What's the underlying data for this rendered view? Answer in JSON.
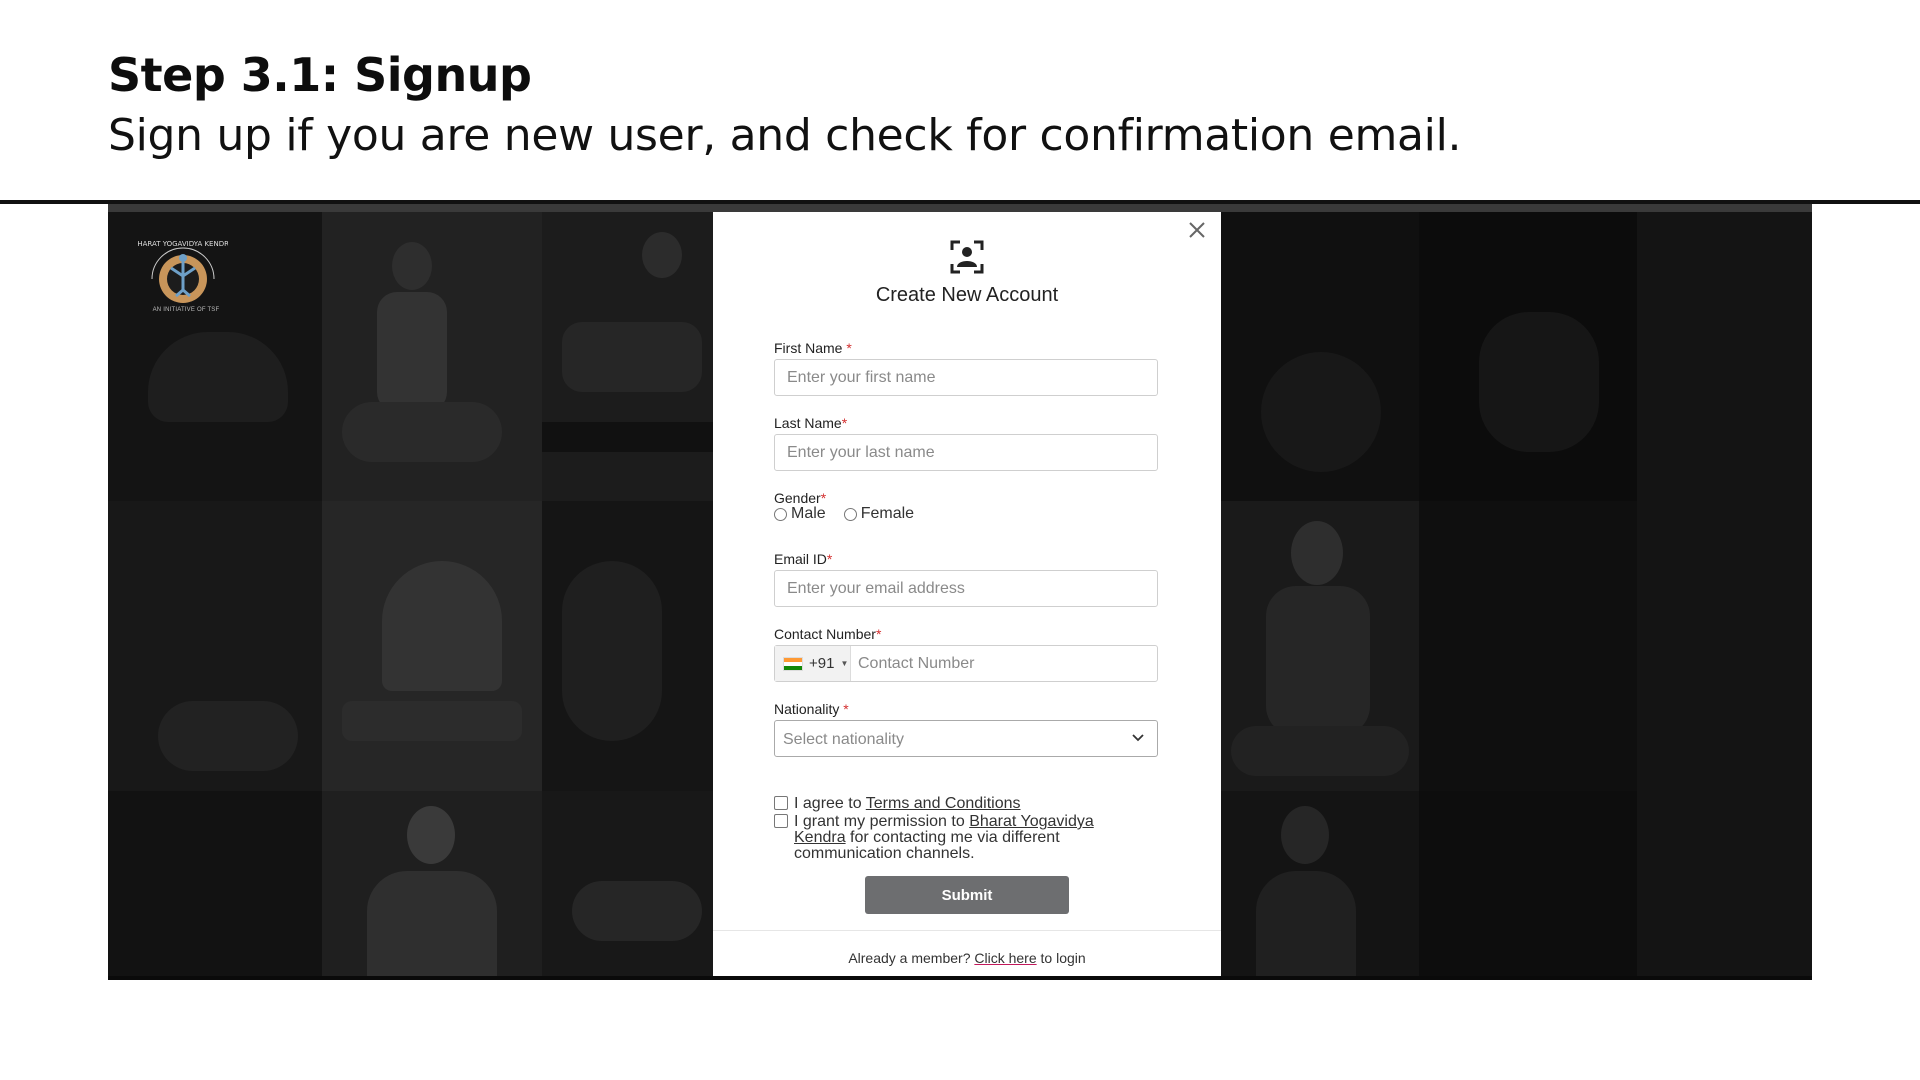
{
  "slide": {
    "title": "Step 3.1: Signup",
    "subtitle": "Sign up if you are new user, and check for confirmation email."
  },
  "logo": {
    "name": "BHARAT YOGAVIDYA KENDRA",
    "caption": "AN INITIATIVE OF TSF"
  },
  "modal": {
    "title": "Create New Account",
    "icons": {
      "header": "account-box-icon",
      "close": "close-icon"
    },
    "fields": {
      "first_name": {
        "label": "First Name",
        "placeholder": "Enter your first name"
      },
      "last_name": {
        "label": "Last Name",
        "placeholder": "Enter your last name"
      },
      "gender": {
        "label": "Gender",
        "options": [
          "Male",
          "Female"
        ]
      },
      "email": {
        "label": "Email ID",
        "placeholder": "Enter your email address"
      },
      "contact": {
        "label": "Contact Number",
        "country_code": "+91",
        "placeholder": "Contact Number"
      },
      "nationality": {
        "label": "Nationality",
        "placeholder": "Select nationality"
      }
    },
    "required_marker": "*",
    "consents": {
      "terms_prefix": "I agree to",
      "terms_link": "Terms and Conditions",
      "permission_prefix": "I grant my permission to",
      "permission_link": "Bharat Yogavidya Kendra",
      "permission_suffix": "for contacting me via different communication channels."
    },
    "submit_label": "Submit",
    "footer": {
      "prefix": "Already a member?",
      "link": "Click here",
      "suffix": "to login"
    }
  },
  "colors": {
    "submit_bg": "#6d6e70",
    "required": "#d32f2f",
    "footer_link_underline": "#c2185b"
  }
}
